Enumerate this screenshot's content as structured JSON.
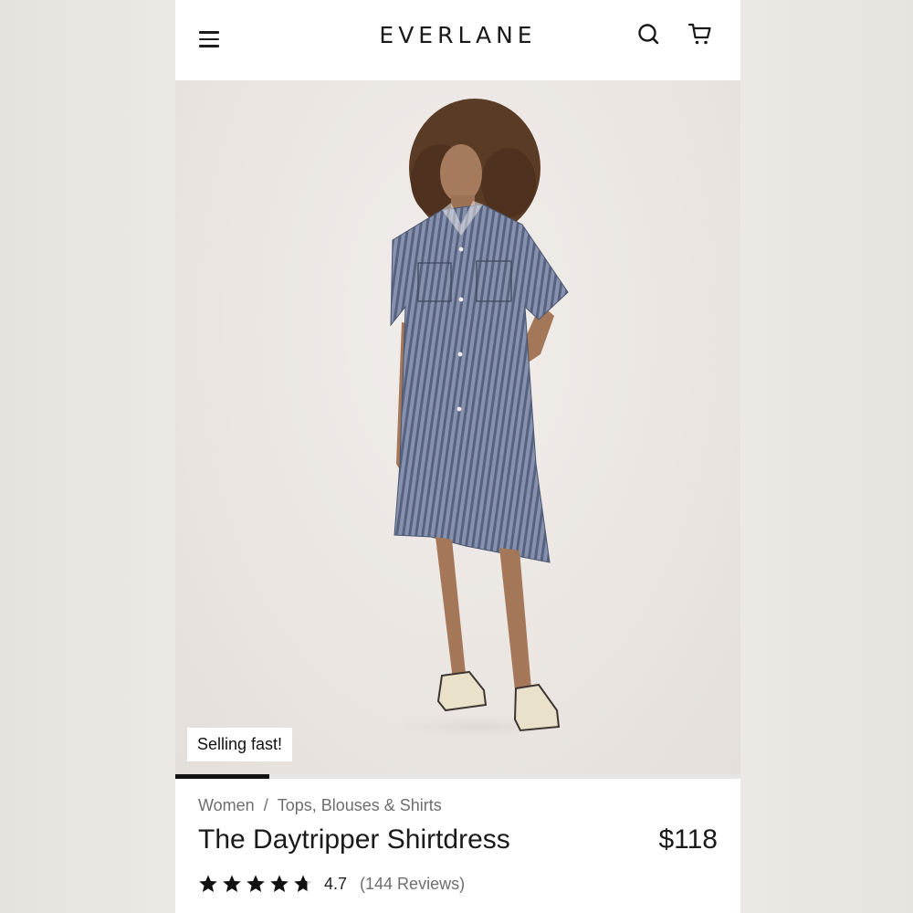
{
  "header": {
    "brand": "EVERLANE",
    "menu_icon": "hamburger-menu-icon",
    "search_icon": "search-icon",
    "cart_icon": "shopping-cart-icon"
  },
  "hero": {
    "badge": "Selling fast!",
    "image_progress_fraction": 0.167
  },
  "breadcrumb": {
    "items": [
      "Women",
      "Tops, Blouses & Shirts"
    ],
    "separator": "/"
  },
  "product": {
    "name": "The Daytripper Shirtdress",
    "price": "$118",
    "rating_value": "4.7",
    "rating_stars": 4.7,
    "reviews": "(144 Reviews)"
  },
  "colors": {
    "text": "#1a1a1a",
    "muted": "#6e6e6e",
    "dress_stripe": "#56627f"
  }
}
